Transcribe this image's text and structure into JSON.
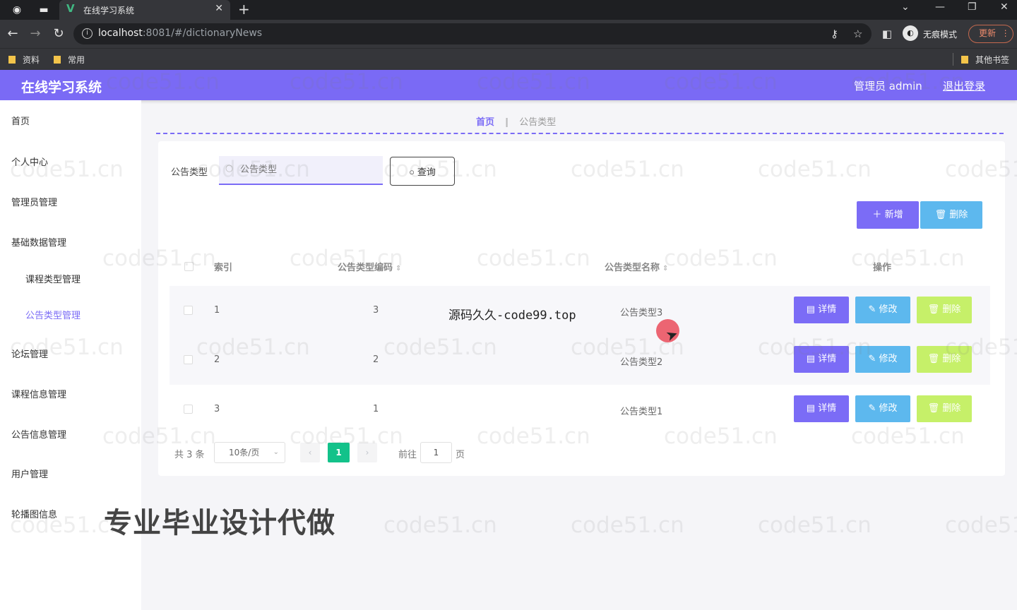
{
  "browser": {
    "tab_title": "在线学习系统",
    "url_host": "localhost",
    "url_rest": ":8081/#/dictionaryNews",
    "incognito_label": "无痕模式",
    "update_label": "更新",
    "bookmarks": [
      "资料",
      "常用"
    ],
    "other_bookmarks": "其他书签"
  },
  "header": {
    "title": "在线学习系统",
    "user_label": "管理员 admin",
    "logout_label": "退出登录"
  },
  "sidebar": {
    "items": [
      "首页",
      "个人中心",
      "管理员管理",
      "基础数据管理",
      "论坛管理",
      "课程信息管理",
      "公告信息管理",
      "用户管理",
      "轮播图信息"
    ],
    "subitems": [
      "课程类型管理",
      "公告类型管理"
    ]
  },
  "breadcrumb": {
    "home": "首页",
    "current": "公告类型"
  },
  "search": {
    "label": "公告类型",
    "placeholder": "公告类型",
    "button_label": "查询"
  },
  "actions": {
    "add_label": "新增",
    "delete_label": "删除"
  },
  "table": {
    "headers": [
      "索引",
      "公告类型编码",
      "公告类型名称",
      "操作"
    ],
    "rows": [
      {
        "index": "1",
        "code": "3",
        "name": "公告类型3"
      },
      {
        "index": "2",
        "code": "2",
        "name": "公告类型2"
      },
      {
        "index": "3",
        "code": "1",
        "name": "公告类型1"
      }
    ],
    "op_labels": {
      "detail": "详情",
      "edit": "修改",
      "delete": "删除"
    }
  },
  "pagination": {
    "total_label": "共 3 条",
    "page_size": "10条/页",
    "current_page": "1",
    "goto_label": "前往",
    "goto_value": "1",
    "page_unit": "页"
  },
  "overlay": {
    "source_text": "源码久久-code99.top",
    "promo_text": "专业毕业设计代做",
    "watermark": "code51.cn"
  },
  "colors": {
    "accent": "#7b6cf6",
    "header_bg": "#7a6af5",
    "edit_btn": "#5db8ee",
    "delete_btn": "#c6f069",
    "active_page": "#13c28a"
  }
}
